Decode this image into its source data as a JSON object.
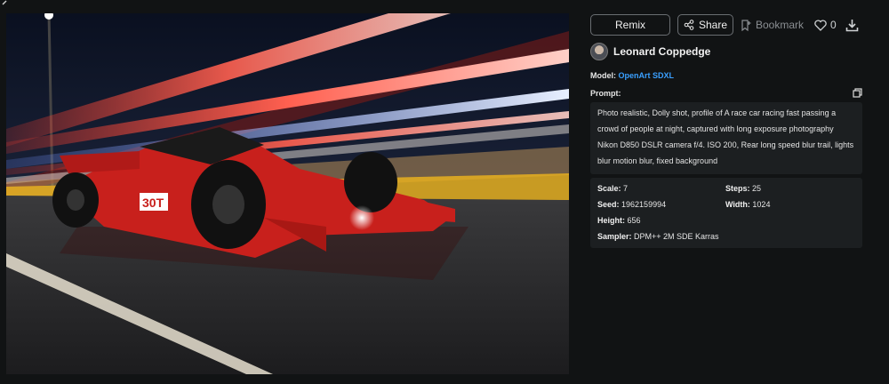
{
  "actions": {
    "remix_label": "Remix",
    "share_label": "Share",
    "bookmark_label": "Bookmark",
    "like_count": "0"
  },
  "author": {
    "name": "Leonard Coppedge"
  },
  "model": {
    "label": "Model:",
    "value": "OpenArt SDXL"
  },
  "prompt": {
    "label": "Prompt:",
    "text": "Photo realistic, Dolly shot, profile of A race car racing fast passing a crowd of people at night, captured with long exposure photography Nikon D850 DSLR camera f/4. ISO 200, Rear long speed blur trail, lights blur motion blur, fixed background"
  },
  "params": {
    "scale_label": "Scale:",
    "scale_value": "7",
    "steps_label": "Steps:",
    "steps_value": "25",
    "seed_label": "Seed:",
    "seed_value": "1962159994",
    "width_label": "Width:",
    "width_value": "1024",
    "height_label": "Height:",
    "height_value": "656",
    "sampler_label": "Sampler:",
    "sampler_value": "DPM++ 2M SDE Karras"
  },
  "image": {
    "car_number": "30T"
  },
  "colors": {
    "accent_link": "#3aa0ff",
    "panel_bg": "#1c1f21",
    "page_bg": "#111314"
  },
  "icons": [
    "back-arrow-icon",
    "share-icon",
    "bookmark-icon",
    "heart-icon",
    "download-icon",
    "copy-icon"
  ]
}
